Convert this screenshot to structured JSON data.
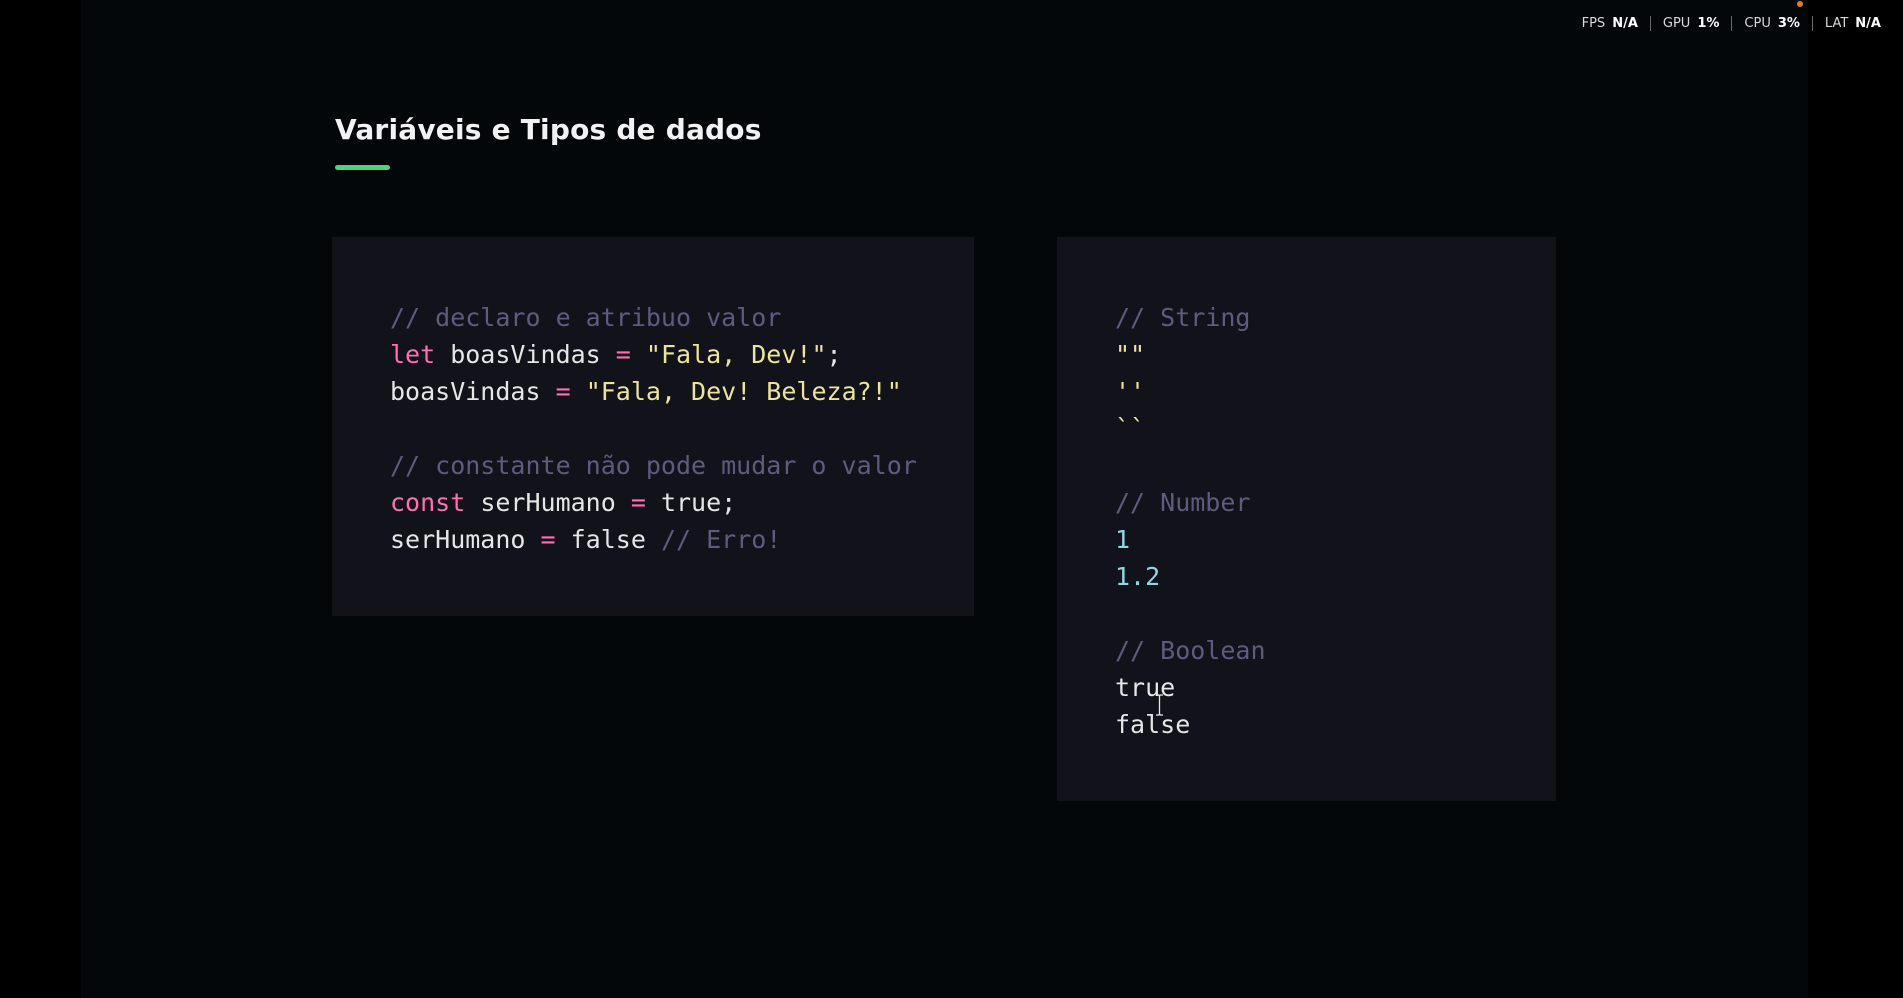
{
  "stats": [
    {
      "label": "FPS",
      "value": "N/A"
    },
    {
      "label": "GPU",
      "value": "1%"
    },
    {
      "label": "CPU",
      "value": "3%"
    },
    {
      "label": "LAT",
      "value": "N/A"
    }
  ],
  "slide": {
    "title": "Variáveis e Tipos de dados",
    "accent_color": "#4fd17e"
  },
  "left_code": {
    "comment1": "// declaro e atribuo valor",
    "line2": {
      "kw": "let",
      "var": " boasVindas ",
      "op": "=",
      "str": " \"Fala, Dev!\"",
      "end": ";"
    },
    "line3": {
      "var": "boasVindas ",
      "op": "=",
      "str": " \"Fala, Dev! Beleza?!\""
    },
    "comment2": "// constante não pode mudar o valor",
    "line5": {
      "kw": "const",
      "var": " serHumano ",
      "op": "=",
      "val": " true",
      "end": ";"
    },
    "line6": {
      "var": "serHumano ",
      "op": "=",
      "val": " false ",
      "comment": "// Erro!"
    }
  },
  "right_code": {
    "string_comment": "// String",
    "string_examples": [
      "\"\"",
      "''",
      "``"
    ],
    "number_comment": "// Number",
    "number_examples": [
      "1",
      "1.2"
    ],
    "boolean_comment": "// Boolean",
    "boolean_examples": [
      "true",
      "false"
    ]
  },
  "colors": {
    "comment": "#5f5b7e",
    "keyword": "#ff6fb1",
    "string": "#ede49a",
    "number": "#8ed7e6",
    "panel_bg": "#11121a"
  }
}
